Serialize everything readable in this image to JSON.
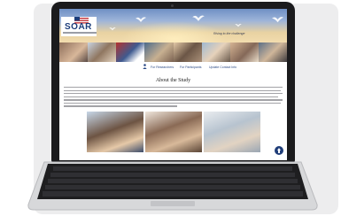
{
  "site": {
    "logo_text": "SOAR",
    "tagline": "Rising to the challenge"
  },
  "nav": {
    "links": [
      "For Researchers",
      "For Participants",
      "Update Contact Info"
    ]
  },
  "about": {
    "title": "About the Study"
  },
  "colors": {
    "brand_navy": "#1d3d7a",
    "link_blue": "#2b4a86",
    "laptop_body": "#1b1b1d",
    "keyboard_frame": "#d7d8da"
  },
  "icons": [
    "people-icon",
    "scroll-up-icon",
    "bird-icon",
    "flag-icon"
  ]
}
